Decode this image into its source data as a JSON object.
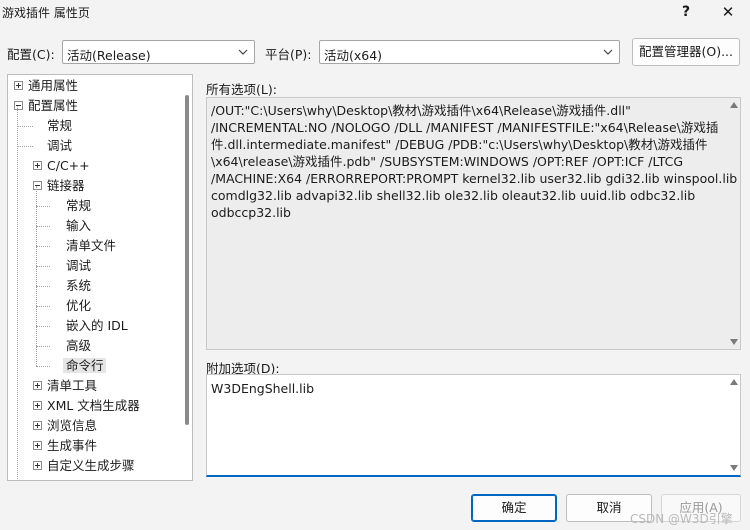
{
  "window": {
    "title": "游戏插件 属性页",
    "help_label": "?",
    "close_label": "✕"
  },
  "config_row": {
    "config_label": "配置(C):",
    "config_value": "活动(Release)",
    "platform_label": "平台(P):",
    "platform_value": "活动(x64)",
    "manager_button": "配置管理器(O)..."
  },
  "tree": {
    "items": [
      {
        "label": "通用属性",
        "expander": "plus"
      },
      {
        "label": "配置属性",
        "expander": "minus"
      },
      {
        "label": "常规",
        "expander": "none"
      },
      {
        "label": "调试",
        "expander": "none"
      },
      {
        "label": "C/C++",
        "expander": "plus"
      },
      {
        "label": "链接器",
        "expander": "minus"
      },
      {
        "label": "常规",
        "expander": "none"
      },
      {
        "label": "输入",
        "expander": "none"
      },
      {
        "label": "清单文件",
        "expander": "none"
      },
      {
        "label": "调试",
        "expander": "none"
      },
      {
        "label": "系统",
        "expander": "none"
      },
      {
        "label": "优化",
        "expander": "none"
      },
      {
        "label": "嵌入的 IDL",
        "expander": "none"
      },
      {
        "label": "高级",
        "expander": "none"
      },
      {
        "label": "命令行",
        "expander": "none",
        "selected": true
      },
      {
        "label": "清单工具",
        "expander": "plus"
      },
      {
        "label": "XML 文档生成器",
        "expander": "plus"
      },
      {
        "label": "浏览信息",
        "expander": "plus"
      },
      {
        "label": "生成事件",
        "expander": "plus"
      },
      {
        "label": "自定义生成步骤",
        "expander": "plus"
      }
    ]
  },
  "all_options": {
    "label": "所有选项(L):",
    "lines": [
      "/OUT:\"C:\\Users\\why\\Desktop\\教材\\游戏插件\\x64\\Release\\游戏插件.dll\"",
      "/INCREMENTAL:NO /NOLOGO /DLL /MANIFEST /MANIFESTFILE:\"x64\\Release\\游戏插",
      "件.dll.intermediate.manifest\" /DEBUG /PDB:\"c:\\Users\\why\\Desktop\\教材\\游戏插件",
      "\\x64\\release\\游戏插件.pdb\" /SUBSYSTEM:WINDOWS /OPT:REF /OPT:ICF /LTCG",
      "/MACHINE:X64 /ERRORREPORT:PROMPT kernel32.lib user32.lib gdi32.lib winspool.lib",
      "comdlg32.lib advapi32.lib shell32.lib ole32.lib oleaut32.lib uuid.lib odbc32.lib",
      "odbccp32.lib"
    ]
  },
  "additional_options": {
    "label": "附加选项(D):",
    "value": "W3DEngShell.lib"
  },
  "buttons": {
    "ok": "确定",
    "cancel": "取消",
    "apply": "应用(A)"
  },
  "watermark": "CSDN @W3D引擎"
}
